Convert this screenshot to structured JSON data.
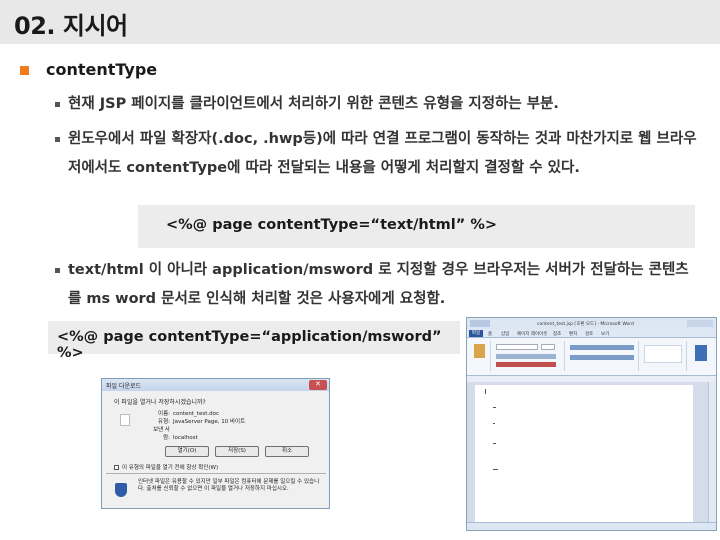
{
  "slide": {
    "title": "02. 지시어",
    "heading": "contentType",
    "bullets": [
      "현재 JSP 페이지를 클라이언트에서 처리하기 위한 콘텐츠 유형을 지정하는 부분.",
      "윈도우에서 파일 확장자(.doc, .hwp등)에 따라 연결 프로그램이 동작하는 것과 마찬가지로 웹 브라우저에서도 contentType에 따라 전달되는 내용을 어떻게 처리할지 결정할 수 있다.",
      "text/html 이 아니라 application/msword 로 지정할 경우 브라우저는 서버가 전달하는 콘텐츠를 ms word 문서로 인식해 처리할 것은 사용자에게 요청함."
    ],
    "code1": "<%@ page contentType=“text/html” %>",
    "code2": "<%@ page contentType=“application/msword” %>"
  },
  "dialog": {
    "title": "파일 다운로드",
    "question": "이 파일을 열거나 저장하시겠습니까?",
    "info": [
      {
        "k": "이름:",
        "v": "content_test.doc"
      },
      {
        "k": "유형:",
        "v": "JavaServer Page, 10 바이트"
      },
      {
        "k": "보낸 사람:",
        "v": "localhost"
      }
    ],
    "buttons": [
      "열기(O)",
      "저장(S)",
      "취소"
    ],
    "checkbox": "이 유형의 파일을 열기 전에 항상 확인(W)",
    "warning": "인터넷 파일은 유용할 수 있지만 일부 파일은 컴퓨터에 문제를 일으킬 수 있습니다. 출처를 신뢰할 수 없으면 이 파일을 열거나 저장하지 마십시오."
  },
  "word": {
    "title": "content_test.jsp [호환 모드] - Microsoft Word",
    "file_tab": "파일",
    "tabs": [
      "홈",
      "삽입",
      "페이지 레이아웃",
      "참조",
      "편지",
      "검토",
      "보기"
    ]
  }
}
